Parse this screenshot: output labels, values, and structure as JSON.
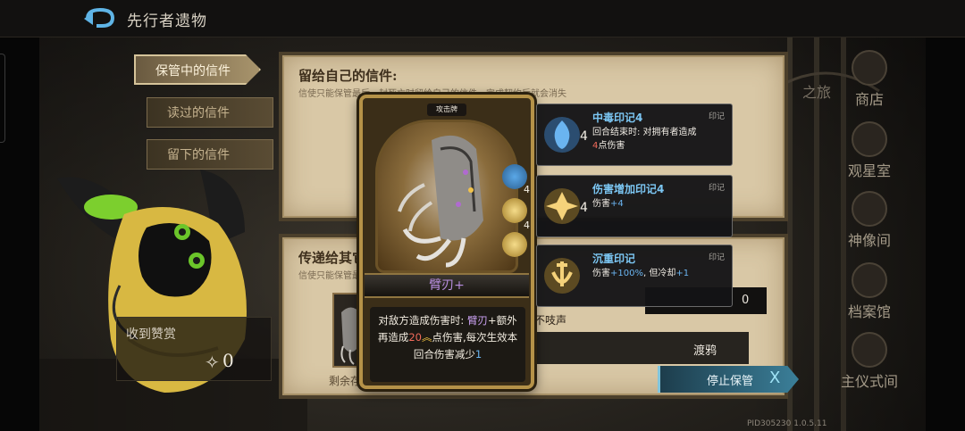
{
  "header": {
    "title": "先行者遗物"
  },
  "tabs": [
    {
      "label": "保管中的信件",
      "active": true
    },
    {
      "label": "读过的信件",
      "active": false
    },
    {
      "label": "留下的信件",
      "active": false
    }
  ],
  "side_menu": {
    "partial_label": "之旅",
    "items": [
      {
        "label": "商店",
        "icon": "shop-icon"
      },
      {
        "label": "观星室",
        "icon": "observatory-icon"
      },
      {
        "label": "神像间",
        "icon": "statue-icon"
      },
      {
        "label": "档案馆",
        "icon": "archive-icon"
      },
      {
        "label": "主仪式间",
        "icon": "ritual-icon"
      }
    ]
  },
  "panels": {
    "self_letter": {
      "title": "留给自己的信件:",
      "subtitle": "信使只能保管最后一封死亡时留给自己的信件，完成契约后就会消失"
    },
    "pass_letter": {
      "title": "传递给其它",
      "subtitle": "信使只能保管最",
      "remaining_label": "剩余存",
      "silent_text": "不吱声",
      "count_value": "0",
      "recipient_name": "渡鸦",
      "stop_button": "停止保管",
      "stop_icon": "X"
    }
  },
  "reward": {
    "label": "收到赞赏",
    "value": "0",
    "icon": "feather-icon"
  },
  "card": {
    "type_label": "攻击牌",
    "name": "臂刃+",
    "desc_parts": [
      "对敌方造成伤害时: ",
      "臂刃",
      "+额外再造成",
      "20",
      "点伤害,",
      "每次生效本回合伤害减少",
      "1"
    ],
    "marks": [
      {
        "icon": "poison-mark-icon",
        "count": "4"
      },
      {
        "icon": "damage-mark-icon",
        "count": "4"
      },
      {
        "icon": "heavy-mark-icon",
        "count": ""
      }
    ]
  },
  "mark_tooltips": [
    {
      "title": "中毒印记4",
      "tag": "印记",
      "stack": "4",
      "body_parts": [
        "回合结束时: 对拥有者造成",
        "4",
        "点伤害"
      ],
      "icon": "poison-mark-icon"
    },
    {
      "title": "伤害增加印记4",
      "tag": "印记",
      "stack": "4",
      "body_parts": [
        "伤害",
        "+4"
      ],
      "icon": "damage-mark-icon"
    },
    {
      "title": "沉重印记",
      "tag": "印记",
      "stack": "",
      "body_parts": [
        "伤害",
        "+100%",
        ", 但冷却",
        "+1"
      ],
      "icon": "heavy-mark-icon"
    }
  ],
  "footer": {
    "version": "PID305230  1.0.5.11"
  },
  "colors": {
    "accent_blue": "#6ab4f0",
    "accent_purple": "#b88ee0",
    "accent_red": "#f06a5a",
    "parchment": "#d9c8a6",
    "gold_frame": "#b59248"
  }
}
